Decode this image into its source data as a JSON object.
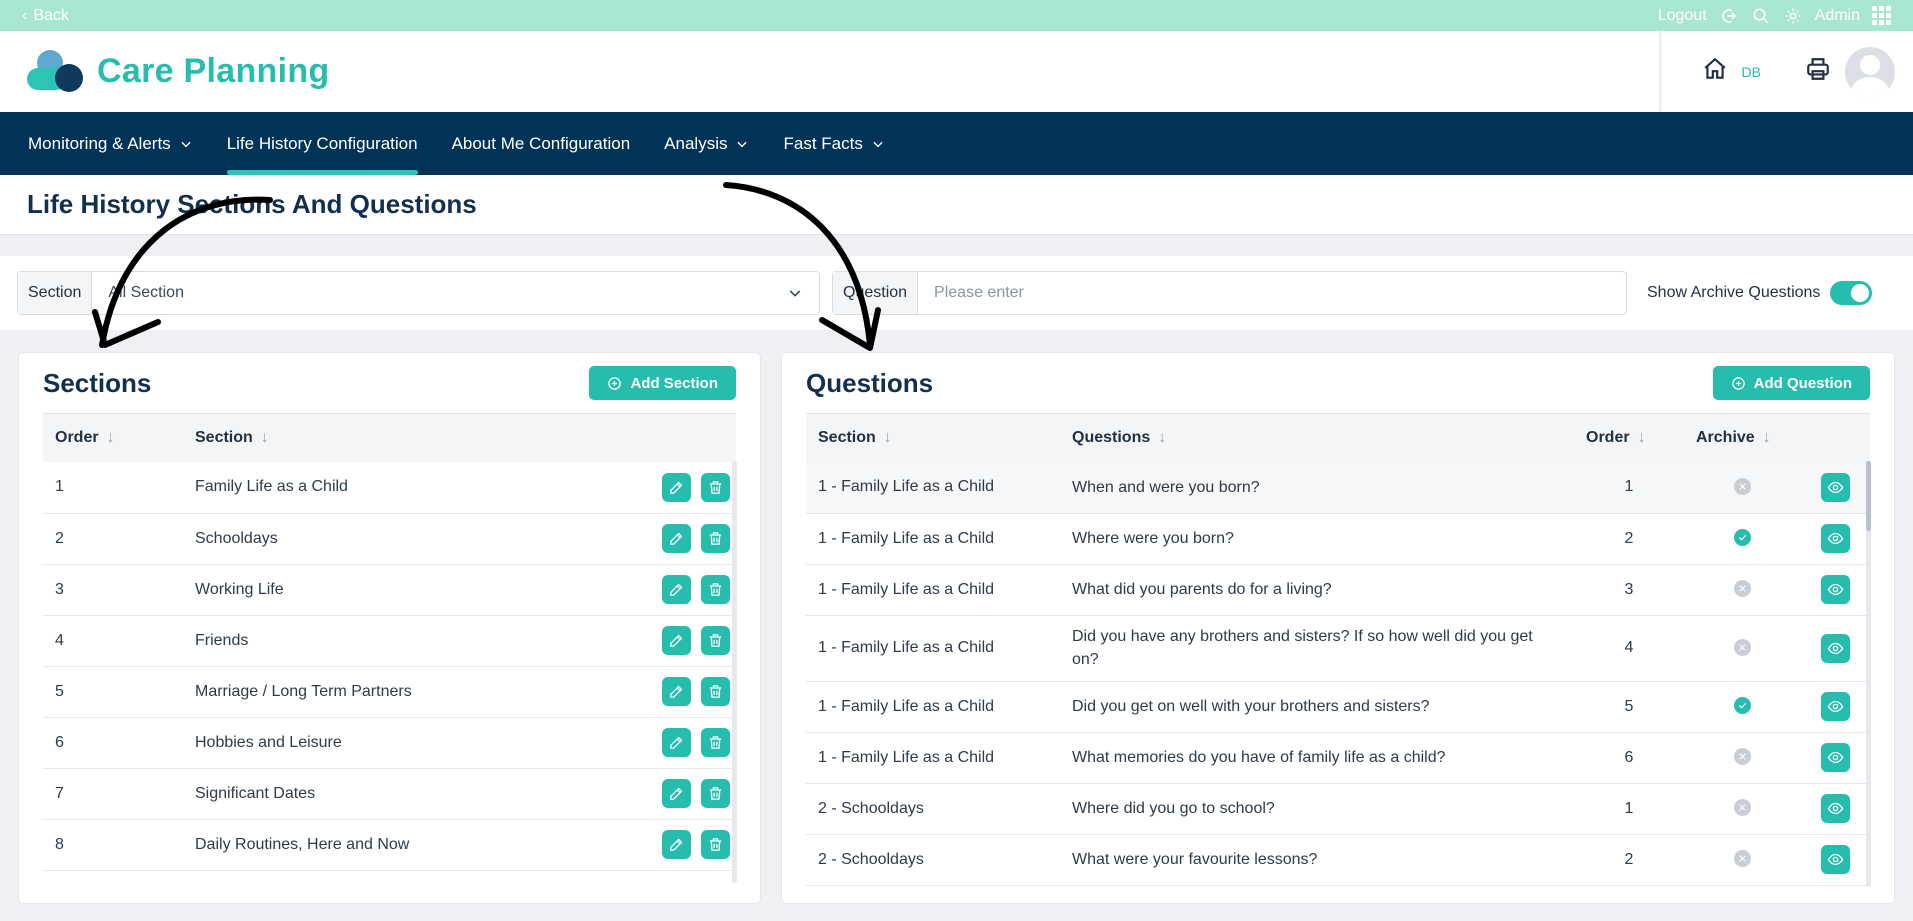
{
  "topbar": {
    "back_label": "Back",
    "logout_label": "Logout",
    "admin_label": "Admin"
  },
  "header": {
    "app_name": "Care Planning",
    "home_tag": "DB"
  },
  "nav": [
    {
      "label": "Monitoring & Alerts",
      "dropdown": true
    },
    {
      "label": "Life History Configuration",
      "dropdown": false,
      "active": true
    },
    {
      "label": "About Me Configuration",
      "dropdown": false
    },
    {
      "label": "Analysis",
      "dropdown": true
    },
    {
      "label": "Fast Facts",
      "dropdown": true
    }
  ],
  "page": {
    "title": "Life History Sections And Questions"
  },
  "filters": {
    "section_label": "Section",
    "section_value": "All Section",
    "question_label": "Question",
    "question_placeholder": "Please enter",
    "archive_toggle_label": "Show Archive Questions",
    "archive_toggle_on": true
  },
  "sections": {
    "title": "Sections",
    "add_button": "Add Section",
    "columns": [
      "Order",
      "Section"
    ],
    "rows": [
      {
        "order": "1",
        "name": "Family Life as a Child"
      },
      {
        "order": "2",
        "name": "Schooldays"
      },
      {
        "order": "3",
        "name": "Working Life"
      },
      {
        "order": "4",
        "name": "Friends"
      },
      {
        "order": "5",
        "name": "Marriage / Long Term Partners"
      },
      {
        "order": "6",
        "name": "Hobbies and Leisure"
      },
      {
        "order": "7",
        "name": "Significant Dates"
      },
      {
        "order": "8",
        "name": "Daily Routines, Here and Now"
      }
    ]
  },
  "questions": {
    "title": "Questions",
    "add_button": "Add Question",
    "columns": [
      "Section",
      "Questions",
      "Order",
      "Archive"
    ],
    "rows": [
      {
        "section": "1 - Family Life as a Child",
        "question": "When and were you born?",
        "order": "1",
        "archived": false
      },
      {
        "section": "1 - Family Life as a Child",
        "question": "Where were you born?",
        "order": "2",
        "archived": true
      },
      {
        "section": "1 - Family Life as a Child",
        "question": "What did you parents do for a living?",
        "order": "3",
        "archived": false
      },
      {
        "section": "1 - Family Life as a Child",
        "question": "Did you have any brothers and sisters? If so how well did you get on?",
        "order": "4",
        "archived": false
      },
      {
        "section": "1 - Family Life as a Child",
        "question": "Did you get on well with your brothers and sisters?",
        "order": "5",
        "archived": true
      },
      {
        "section": "1 - Family Life as a Child",
        "question": "What memories do you have of family life as a child?",
        "order": "6",
        "archived": false
      },
      {
        "section": "2 - Schooldays",
        "question": "Where did you go to school?",
        "order": "1",
        "archived": false
      },
      {
        "section": "2 - Schooldays",
        "question": "What were your favourite lessons?",
        "order": "2",
        "archived": false
      }
    ]
  },
  "colors": {
    "accent": "#27bdae",
    "nav_bg": "#003356",
    "top_strip": "#a8e6cf",
    "title_text": "#12304d"
  }
}
